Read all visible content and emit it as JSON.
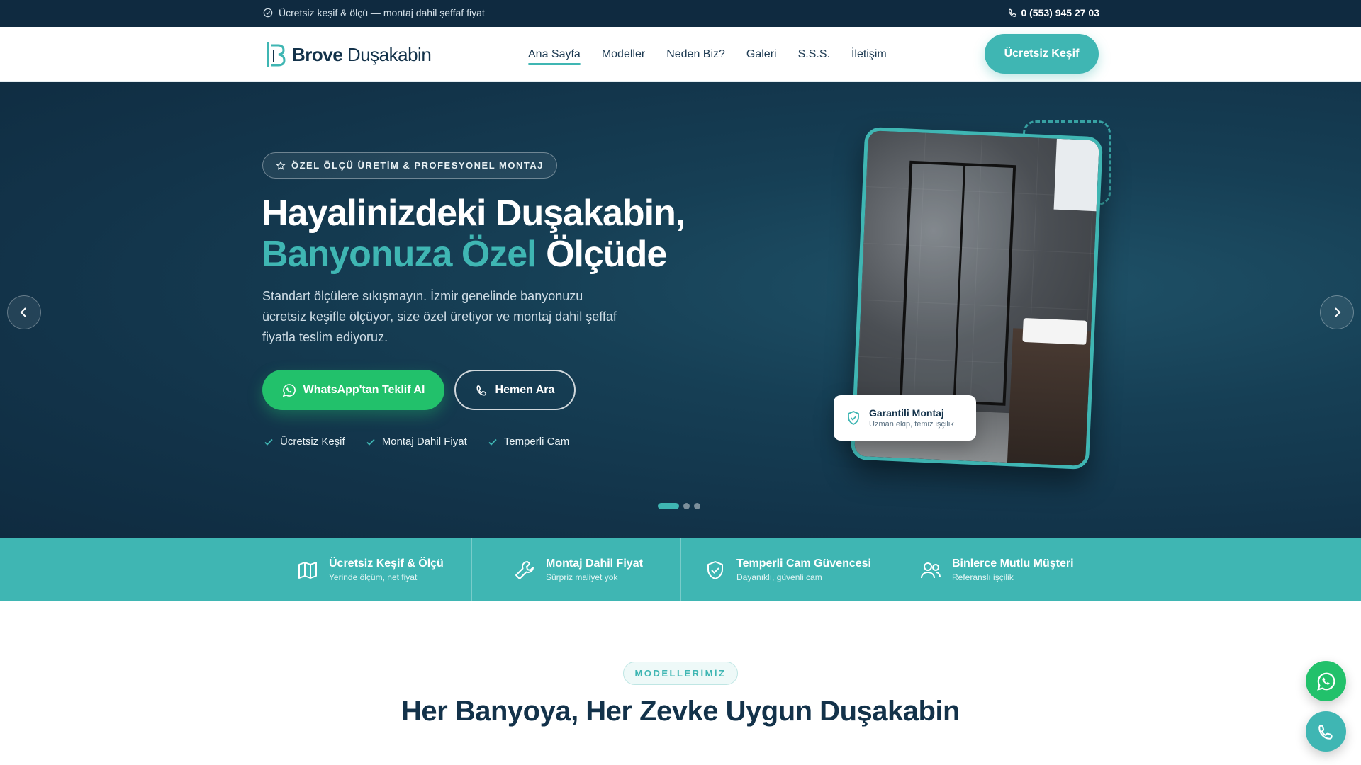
{
  "topbar": {
    "notice": "Ücretsiz keşif & ölçü — montaj dahil şeffaf fiyat",
    "phone": "0 (553) 945 27 03"
  },
  "header": {
    "brand_bold": "Brove",
    "brand_rest": " Duşakabin",
    "nav": [
      "Ana Sayfa",
      "Modeller",
      "Neden Biz?",
      "Galeri",
      "S.S.S.",
      "İletişim"
    ],
    "active_nav": "Ana Sayfa",
    "cta": "Ücretsiz Keşif"
  },
  "hero": {
    "badge": "ÖZEL ÖLÇÜ ÜRETİM & PROFESYONEL MONTAJ",
    "title_line1": "Hayalinizdeki Duşakabin,",
    "title_accent": "Banyonuza Özel",
    "title_rest": " Ölçüde",
    "lead": "Standart ölçülere sıkışmayın. İzmir genelinde banyonuzu ücretsiz keşifle ölçüyor, size özel üretiyor ve montaj dahil şeffaf fiyatla teslim ediyoruz.",
    "btn_whatsapp": "WhatsApp'tan Teklif Al",
    "btn_call": "Hemen Ara",
    "checks": [
      "Ücretsiz Keşif",
      "Montaj Dahil Fiyat",
      "Temperli Cam"
    ],
    "guarantee_title": "Garantili Montaj",
    "guarantee_sub": "Uzman ekip, temiz işçilik",
    "slides_total": 3,
    "slide_active": 1
  },
  "features": [
    {
      "title": "Ücretsiz Keşif & Ölçü",
      "sub": "Yerinde ölçüm, net fiyat",
      "icon": "map-icon"
    },
    {
      "title": "Montaj Dahil Fiyat",
      "sub": "Sürpriz maliyet yok",
      "icon": "wrench-icon"
    },
    {
      "title": "Temperli Cam Güvencesi",
      "sub": "Dayanıklı, güvenli cam",
      "icon": "shield-check-icon"
    },
    {
      "title": "Binlerce Mutlu Müşteri",
      "sub": "Referanslı işçilik",
      "icon": "users-icon"
    }
  ],
  "section": {
    "badge": "MODELLERİMİZ",
    "title": "Her Banyoya, Her Zevke Uygun Duşakabin"
  },
  "colors": {
    "accent": "#3fb6b3",
    "navy": "#0f2a40",
    "whatsapp": "#22c16b"
  }
}
